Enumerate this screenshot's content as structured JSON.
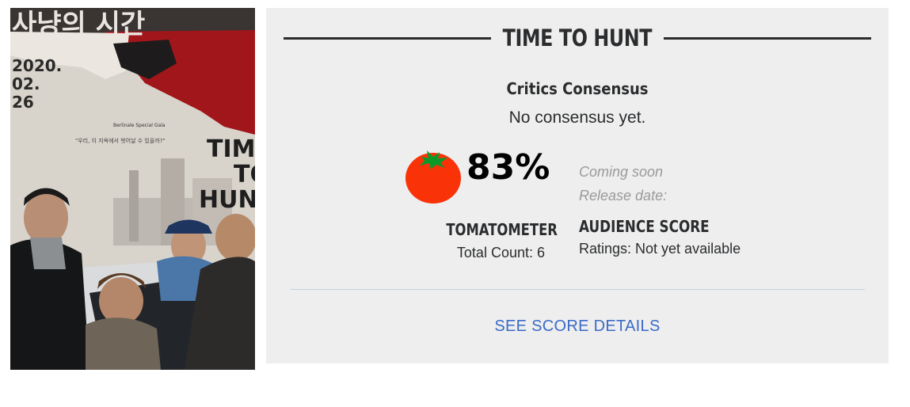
{
  "poster": {
    "korean_title": "사냥의 시간",
    "release_date_lines": [
      "2020.",
      "02.",
      "26"
    ],
    "festival_text": "Berlinale Special Gala",
    "tagline_korean": "\"우리, 이 지옥에서 벗어날 수 있을까?\"",
    "poster_title_lines": [
      "TIME",
      "TO",
      "HUNT"
    ]
  },
  "panel": {
    "title": "TIME TO HUNT",
    "consensus_heading": "Critics Consensus",
    "consensus_text": "No consensus yet.",
    "tomatometer": {
      "score": "83%",
      "label": "TOMATOMETER",
      "total_count": "Total Count: 6",
      "icon": "tomato-icon"
    },
    "audience": {
      "coming_soon": "Coming soon",
      "release_date": "Release date:",
      "label": "AUDIENCE SCORE",
      "ratings": "Ratings: Not yet available"
    },
    "see_details": "SEE SCORE DETAILS"
  },
  "colors": {
    "panel_bg": "#eeeeee",
    "tomato_red": "#f93208",
    "link_blue": "#3a6bc8",
    "text_dark": "#2a2c2e"
  }
}
